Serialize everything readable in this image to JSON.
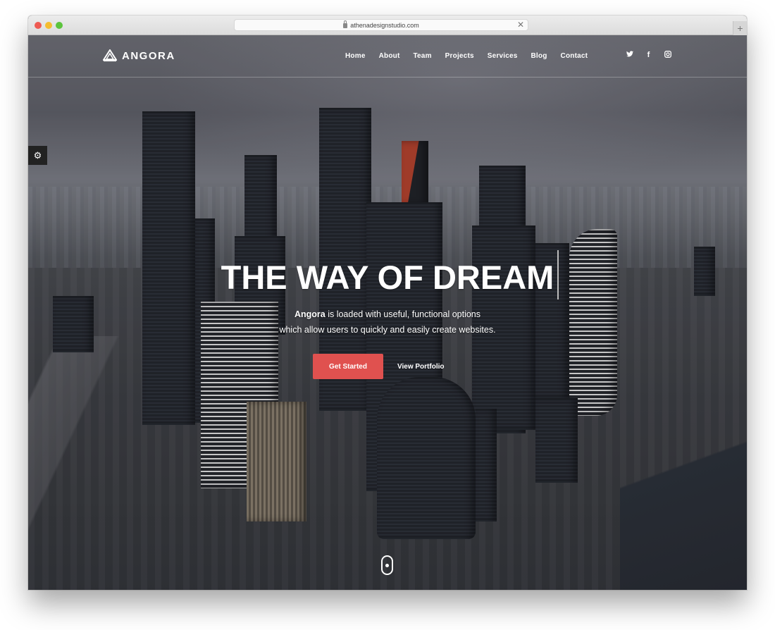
{
  "browser": {
    "url": "athenadesignstudio.com",
    "new_tab_label": "+",
    "close_label": "✕"
  },
  "site": {
    "brand": "ANGORA",
    "nav": [
      {
        "label": "Home"
      },
      {
        "label": "About"
      },
      {
        "label": "Team"
      },
      {
        "label": "Projects"
      },
      {
        "label": "Services"
      },
      {
        "label": "Blog"
      },
      {
        "label": "Contact"
      }
    ],
    "social": [
      {
        "icon": "twitter-icon",
        "glyph": "🐦"
      },
      {
        "icon": "facebook-icon",
        "glyph": "f"
      },
      {
        "icon": "instagram-icon",
        "glyph": "◎"
      }
    ],
    "settings_glyph": "⚙"
  },
  "hero": {
    "headline": "THE WAY OF DREAM",
    "sub_bold": "Angora",
    "sub_line1_rest": " is loaded with useful, functional options",
    "sub_line2": "which allow users to quickly and easily create websites.",
    "primary_cta": "Get Started",
    "secondary_cta": "View Portfolio"
  },
  "colors": {
    "accent": "#e0514f",
    "nav_text": "#ffffff"
  }
}
